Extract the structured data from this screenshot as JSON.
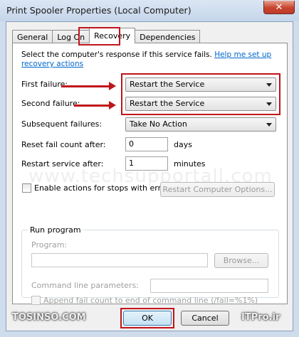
{
  "window": {
    "title": "Print Spooler Properties (Local Computer)",
    "close_glyph": "✕"
  },
  "tabs": [
    {
      "label": "General",
      "active": false
    },
    {
      "label": "Log On",
      "active": false
    },
    {
      "label": "Recovery",
      "active": true
    },
    {
      "label": "Dependencies",
      "active": false
    }
  ],
  "recovery": {
    "description": "Select the computer's response if this service fails.",
    "help_link": "Help me set up recovery actions",
    "first_failure_label": "First failure:",
    "first_failure_value": "Restart the Service",
    "second_failure_label": "Second failure:",
    "second_failure_value": "Restart the Service",
    "subsequent_failures_label": "Subsequent failures:",
    "subsequent_failures_value": "Take No Action",
    "reset_fail_count_label": "Reset fail count after:",
    "reset_fail_count_value": "0",
    "reset_fail_count_unit": "days",
    "restart_service_label": "Restart service after:",
    "restart_service_value": "1",
    "restart_service_unit": "minutes",
    "enable_actions_label": "Enable actions for stops with errors.",
    "restart_computer_options_label": "Restart Computer Options..."
  },
  "run_program": {
    "group_label": "Run program",
    "program_label": "Program:",
    "browse_label": "Browse...",
    "command_line_label": "Command line parameters:",
    "append_fail_count_label": "Append fail count to end of command line (/fail=%1%)"
  },
  "buttons": {
    "ok": "OK",
    "cancel": "Cancel"
  },
  "watermarks": {
    "center": "www.techsupportall.com",
    "footer_left": "TOSINSO.COM",
    "footer_right": "ITPro.ir"
  },
  "colors": {
    "annotation_red": "#c0141b",
    "link_blue": "#0066cc",
    "close_red": "#c7442d"
  }
}
